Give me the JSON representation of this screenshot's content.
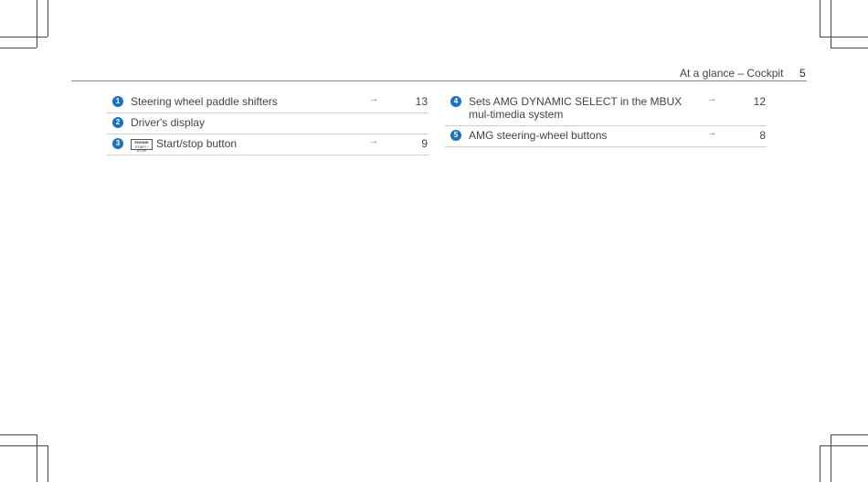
{
  "header": {
    "title": "At a glance – Cockpit",
    "page": "5"
  },
  "left_items": [
    {
      "num": "1",
      "label": "Steering wheel paddle shifters",
      "arrow": "→",
      "page": "13"
    },
    {
      "num": "2",
      "label": "Driver's display",
      "arrow": "",
      "page": ""
    },
    {
      "num": "3",
      "label": "Start/stop button",
      "icon_text": [
        "ENGINE",
        "START / STOP"
      ],
      "arrow": "→",
      "page": "9"
    }
  ],
  "right_items": [
    {
      "num": "4",
      "label": "Sets AMG DYNAMIC SELECT in the MBUX mul-timedia system",
      "arrow": "→",
      "page": "12"
    },
    {
      "num": "5",
      "label": "AMG steering-wheel buttons",
      "arrow": "→",
      "page": "8"
    }
  ]
}
